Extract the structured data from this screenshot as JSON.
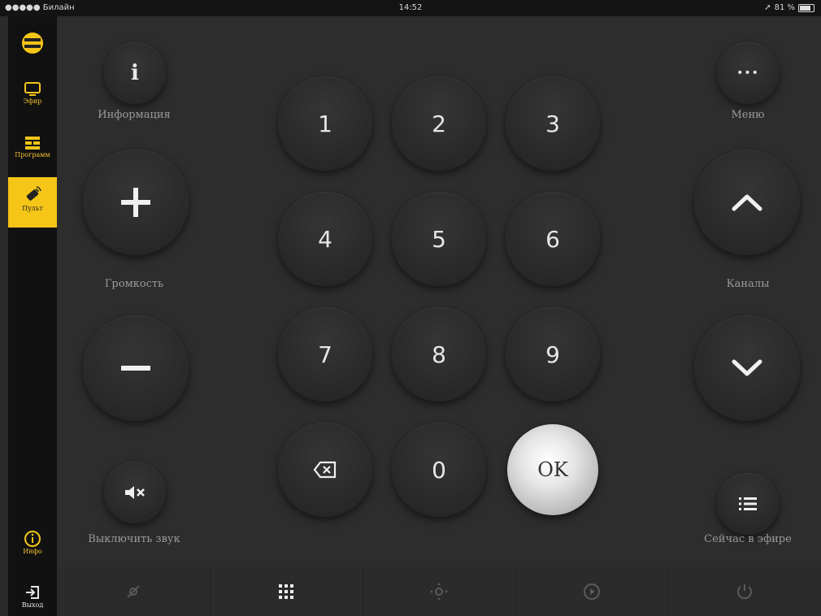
{
  "status_bar": {
    "carrier": "●●●●● Билайн",
    "time": "14:52",
    "battery": "81 %"
  },
  "sidebar": {
    "items": [
      {
        "label": "",
        "icon": "menu-icon"
      },
      {
        "label": "Эфир",
        "icon": "tv-icon"
      },
      {
        "label": "Программ",
        "icon": "program-icon"
      },
      {
        "label": "Пульт",
        "icon": "remote-icon"
      },
      {
        "label": "Инфо",
        "icon": "info-icon"
      },
      {
        "label": "Выход",
        "icon": "exit-icon"
      }
    ],
    "accent_color": "#f5c518"
  },
  "remote": {
    "info_label": "Информация",
    "info_glyph": "i",
    "menu_label": "Меню",
    "menu_glyph": "•••",
    "volume_label": "Громкость",
    "channels_label": "Каналы",
    "mute_label": "Выключить звук",
    "now_on_air_label": "Сейчас в эфире",
    "keys": [
      "1",
      "2",
      "3",
      "4",
      "5",
      "6",
      "7",
      "8",
      "9"
    ],
    "zero": "0",
    "ok": "OK"
  },
  "bottom_tabs": [
    {
      "icon": "swipe-icon"
    },
    {
      "icon": "numpad-icon"
    },
    {
      "icon": "dpad-icon"
    },
    {
      "icon": "play-icon"
    },
    {
      "icon": "power-icon"
    }
  ]
}
